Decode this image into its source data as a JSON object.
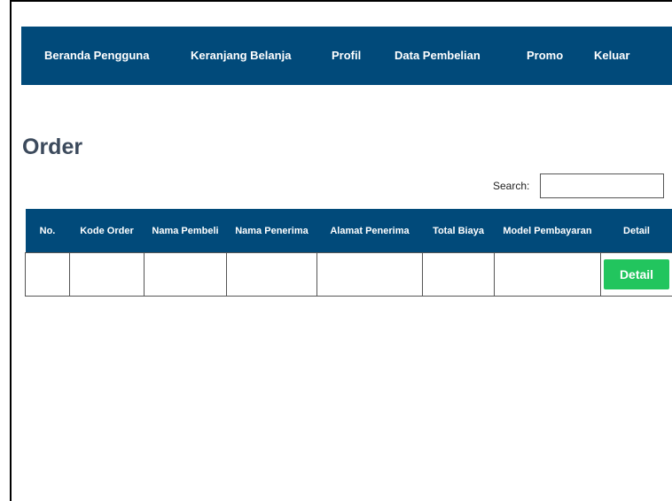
{
  "nav": {
    "items": [
      {
        "label": "Beranda Pengguna"
      },
      {
        "label": "Keranjang Belanja"
      },
      {
        "label": "Profil"
      },
      {
        "label": "Data Pembelian"
      },
      {
        "label": "Promo"
      },
      {
        "label": "Keluar"
      }
    ]
  },
  "colors": {
    "navbar": "#014a7a",
    "detail_button": "#22c55e",
    "title": "#3c4a5c"
  },
  "page": {
    "title": "Order"
  },
  "search": {
    "label": "Search:",
    "value": ""
  },
  "table": {
    "headers": [
      "No.",
      "Kode Order",
      "Nama Pembeli",
      "Nama Penerima",
      "Alamat Penerima",
      "Total Biaya",
      "Model Pembayaran",
      "Detail"
    ],
    "rows": [
      {
        "cells": [
          "",
          "",
          "",
          "",
          "",
          "",
          ""
        ],
        "action_label": "Detail"
      }
    ]
  }
}
